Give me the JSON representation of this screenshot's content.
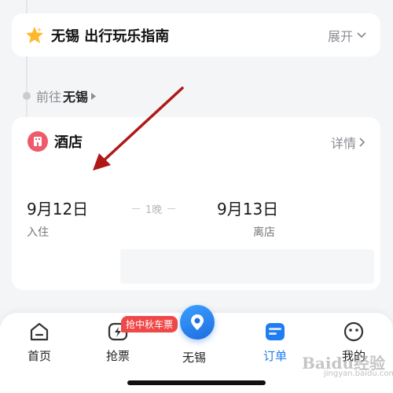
{
  "guide": {
    "title": "无锡 出行玩乐指南",
    "expand_label": "展开"
  },
  "destination": {
    "prefix": "前往",
    "city": "无锡"
  },
  "hotel": {
    "title": "酒店",
    "detail_label": "详情",
    "checkin": {
      "date": "9月12日",
      "label": "入住"
    },
    "nights": "1晚",
    "checkout": {
      "date": "9月13日",
      "label": "离店"
    }
  },
  "tabbar": {
    "items": [
      {
        "label": "首页",
        "icon": "home-icon"
      },
      {
        "label": "抢票",
        "icon": "lightning-ticket-icon",
        "badge": "抢中秋车票"
      },
      {
        "label": "无锡",
        "icon": "location-pin-icon"
      },
      {
        "label": "订单",
        "icon": "order-icon",
        "active": true
      },
      {
        "label": "我的",
        "icon": "profile-face-icon"
      }
    ],
    "active_color": "#1f7cf2"
  },
  "watermark": {
    "text": "Baidu经验",
    "sub": "jingyan.baidu.com"
  },
  "colors": {
    "hotel_icon": "#ee5a6a",
    "annotation_arrow": "#b01818",
    "badge": "#f04848"
  }
}
